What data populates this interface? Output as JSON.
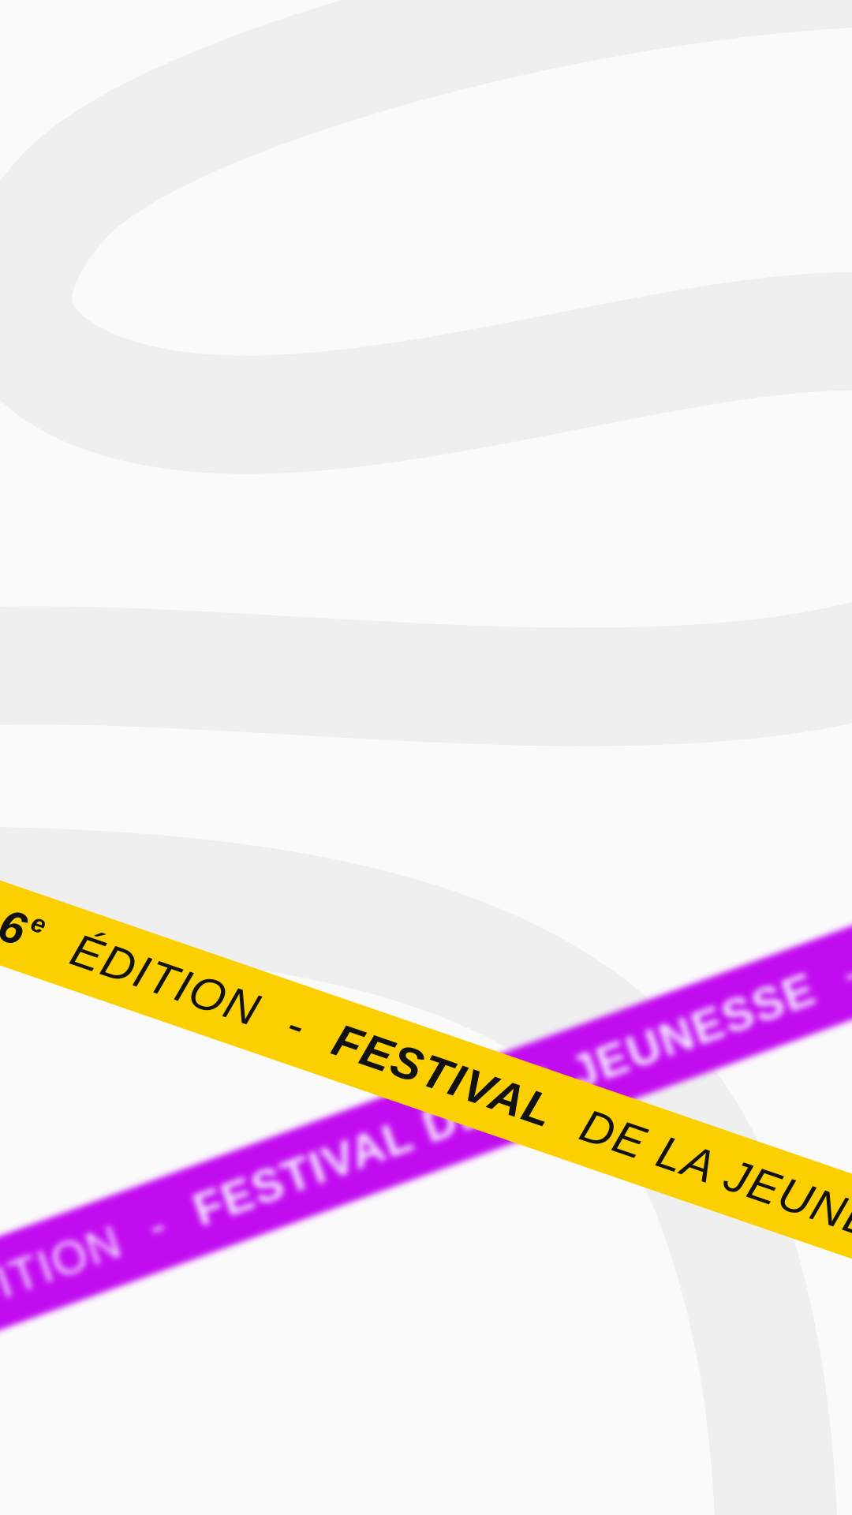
{
  "colors": {
    "background": "#fafafa",
    "swirl": "#efefef",
    "ribbon_yellow": "#fcd000",
    "ribbon_purple": "#c20cf0"
  },
  "ribbon_yellow": {
    "dash_1": "-",
    "edition_num": "6",
    "edition_sup": "e",
    "edition_word": "ÉDITION",
    "dash_2": "-",
    "festival_word": "FESTIVAL",
    "rest": "DE LA JEUNESSE"
  },
  "ribbon_purple": {
    "edition_word": "ÉDITION",
    "dash_1": "-",
    "festival_text": "FESTIVAL DE LA JEUNESSE",
    "dash_2": "-"
  }
}
